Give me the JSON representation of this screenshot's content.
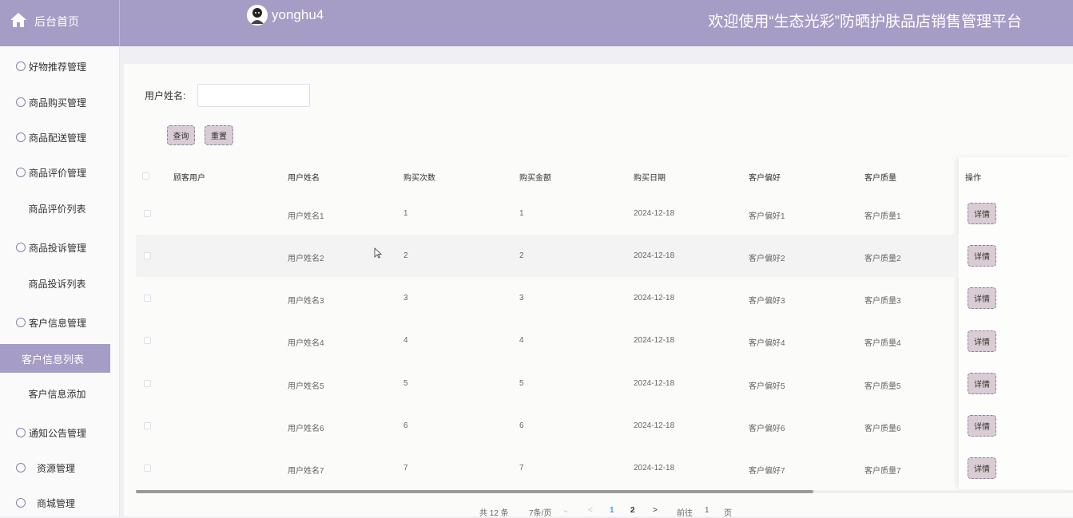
{
  "header": {
    "home_label": "后台首页",
    "username": "yonghu4",
    "title": "欢迎使用“生态光彩”防晒护肤品店销售管理平台"
  },
  "sidebar": {
    "items": [
      {
        "label": "好物推荐管理",
        "icon": "gift-icon"
      },
      {
        "label": "商品购买管理",
        "icon": "circle-icon"
      },
      {
        "label": "商品配送管理",
        "icon": "star-icon"
      },
      {
        "label": "商品评价管理",
        "icon": "compass-icon"
      },
      {
        "label": "商品评价列表"
      },
      {
        "label": "商品投诉管理",
        "icon": "power-icon"
      },
      {
        "label": "商品投诉列表"
      },
      {
        "label": "客户信息管理",
        "icon": "calendar-check-icon"
      },
      {
        "label": "客户信息列表"
      },
      {
        "label": "客户信息添加"
      },
      {
        "label": "通知公告管理",
        "icon": "calendar-check-icon"
      },
      {
        "label": "资源管理",
        "icon": "circle-icon"
      },
      {
        "label": "商城管理",
        "icon": "power-icon"
      }
    ]
  },
  "search": {
    "label": "用户姓名:",
    "value": "",
    "query_btn": "查询",
    "reset_btn": "重置"
  },
  "table": {
    "headers": [
      "顾客用户",
      "用户姓名",
      "购买次数",
      "购买金额",
      "购买日期",
      "客户偏好",
      "客户质量",
      "操作"
    ],
    "rows": [
      {
        "user": "",
        "name": "用户姓名1",
        "count": "1",
        "amount": "1",
        "date": "2024-12-18",
        "pref": "客户偏好1",
        "quality": "客户质量1",
        "op": "详情"
      },
      {
        "user": "",
        "name": "用户姓名2",
        "count": "2",
        "amount": "2",
        "date": "2024-12-18",
        "pref": "客户偏好2",
        "quality": "客户质量2",
        "op": "详情"
      },
      {
        "user": "",
        "name": "用户姓名3",
        "count": "3",
        "amount": "3",
        "date": "2024-12-18",
        "pref": "客户偏好3",
        "quality": "客户质量3",
        "op": "详情"
      },
      {
        "user": "",
        "name": "用户姓名4",
        "count": "4",
        "amount": "4",
        "date": "2024-12-18",
        "pref": "客户偏好4",
        "quality": "客户质量4",
        "op": "详情"
      },
      {
        "user": "",
        "name": "用户姓名5",
        "count": "5",
        "amount": "5",
        "date": "2024-12-18",
        "pref": "客户偏好5",
        "quality": "客户质量5",
        "op": "详情"
      },
      {
        "user": "",
        "name": "用户姓名6",
        "count": "6",
        "amount": "6",
        "date": "2024-12-18",
        "pref": "客户偏好6",
        "quality": "客户质量6",
        "op": "详情"
      },
      {
        "user": "",
        "name": "用户姓名7",
        "count": "7",
        "amount": "7",
        "date": "2024-12-18",
        "pref": "客户偏好7",
        "quality": "客户质量7",
        "op": "详情"
      }
    ]
  },
  "pagination": {
    "total": "共 12 条",
    "page_size": "7条/页",
    "prev": "<",
    "page1": "1",
    "page2": "2",
    "next": ">",
    "goto_label": "前往",
    "goto_value": "1",
    "page_unit": "页"
  },
  "colors": {
    "accent": "#a59dc6",
    "button_bg": "#d9ccd2",
    "page_bg": "#fbfbfa"
  }
}
